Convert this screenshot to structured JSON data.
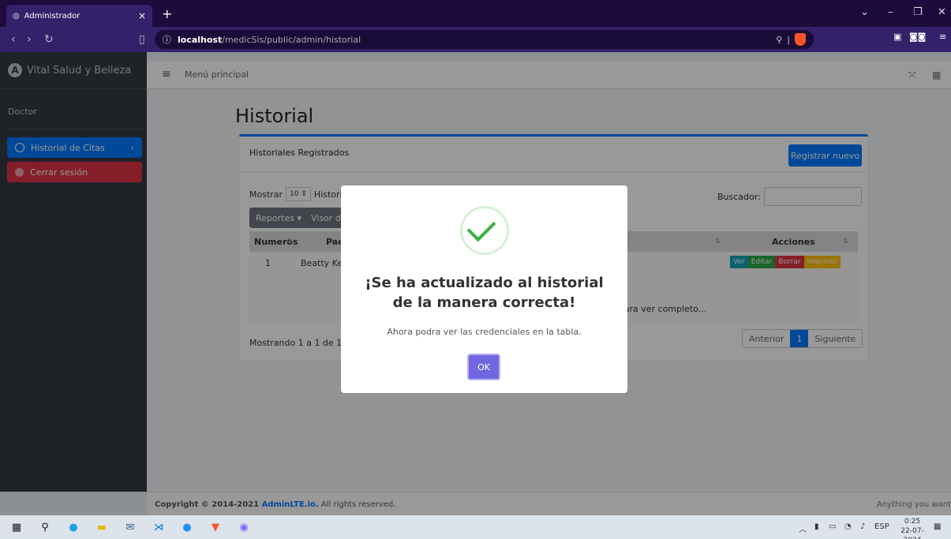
{
  "browser": {
    "tab_title": "Administrador",
    "tab_close": "×",
    "new_tab": "+",
    "url_host": "localhost",
    "url_path": "/medicSis/public/admin/historial"
  },
  "app": {
    "brand": "Vital Salud y Belleza",
    "brand_letter": "A",
    "menu_label": "Menú principal"
  },
  "sidebar": {
    "user": "Doctor",
    "items": [
      {
        "label": "Historial de Citas",
        "arrow": "‹"
      },
      {
        "label": "Cerrar sesión"
      }
    ]
  },
  "main": {
    "title": "Historial",
    "card_title": "Historiales Registrados",
    "new_button": "Registrar nuevo",
    "show_label": "Mostrar",
    "show_value": "10",
    "show_suffix": "Historiales",
    "search_label": "Buscador:",
    "reports_button": "Reportes ▾",
    "visor_button": "Visor de columnas",
    "table": {
      "headers": [
        "Numeros",
        "Paciente",
        "Acciones"
      ],
      "row": {
        "numero": "1",
        "paciente": "Beatty Keeling",
        "detalle": "Presione 'Ver' para ver completo..."
      },
      "actions": [
        "Ver",
        "Editar",
        "Borrar",
        "Imprimir"
      ]
    },
    "showing": "Mostrando 1 a 1 de 1 Historiales",
    "pager": {
      "prev": "Anterior",
      "current": "1",
      "next": "Siguiente"
    }
  },
  "footer": {
    "copy_prefix": "Copyright © 2014-2021 ",
    "copy_link": "AdminLTE.io.",
    "copy_suffix": " All rights reserved.",
    "right": "Anything you want"
  },
  "modal": {
    "title": "¡Se ha actualizado al historial de la manera correcta!",
    "text": "Ahora podra ver las credenciales en la tabla.",
    "ok": "OK"
  },
  "taskbar": {
    "lang": "ESP",
    "time": "0:25",
    "date": "22-07-2024"
  },
  "colors": {
    "primary": "#007bff",
    "danger": "#dc3545",
    "success": "#28a745",
    "warning": "#ffc107",
    "info": "#17a2b8",
    "modal_button": "#7066e0"
  }
}
